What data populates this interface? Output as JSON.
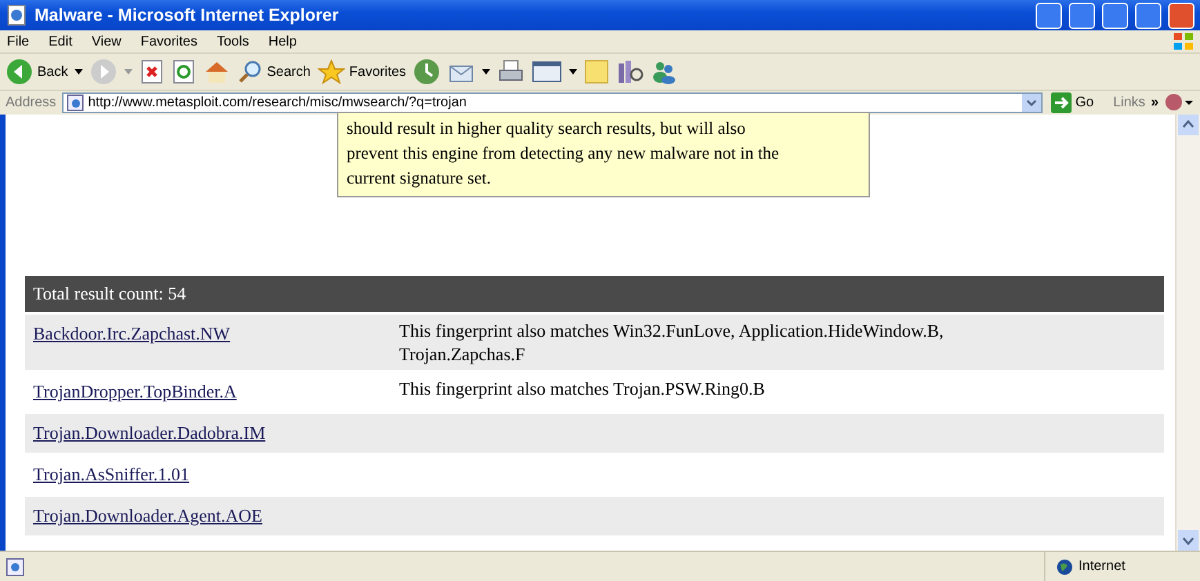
{
  "window": {
    "title": "Malware - Microsoft Internet Explorer"
  },
  "menu": [
    "File",
    "Edit",
    "View",
    "Favorites",
    "Tools",
    "Help"
  ],
  "toolbar": {
    "back": "Back",
    "search": "Search",
    "favorites": "Favorites"
  },
  "address": {
    "label": "Address",
    "value": "http://www.metasploit.com/research/misc/mwsearch/?q=trojan",
    "go": "Go",
    "links": "Links",
    "chevron": "»"
  },
  "notice": {
    "lines": [
      "should result in higher quality search results, but will also",
      "prevent this engine from detecting any new malware not in the",
      "current signature set."
    ]
  },
  "results": {
    "header": "Total result count: 54",
    "rows": [
      {
        "name": "Backdoor.Irc.Zapchast.NW",
        "note": "This fingerprint also matches Win32.FunLove, Application.HideWindow.B, Trojan.Zapchas.F"
      },
      {
        "name": "TrojanDropper.TopBinder.A",
        "note": "This fingerprint also matches Trojan.PSW.Ring0.B"
      },
      {
        "name": "Trojan.Downloader.Dadobra.IM"
      },
      {
        "name": "Trojan.AsSniffer.1.01"
      },
      {
        "name": "Trojan.Downloader.Agent.AOE"
      }
    ]
  },
  "status_bar": {
    "zone": "Internet"
  }
}
